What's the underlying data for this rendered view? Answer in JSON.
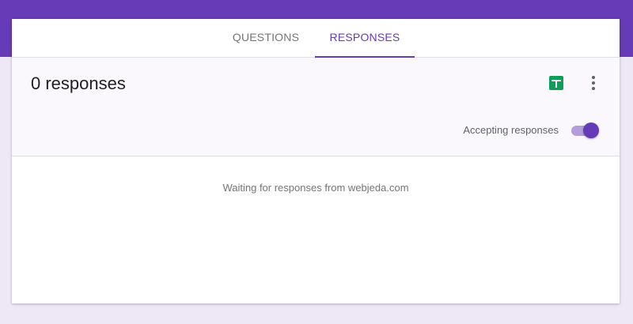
{
  "tabs": [
    {
      "label": "QUESTIONS",
      "active": false
    },
    {
      "label": "RESPONSES",
      "active": true
    }
  ],
  "summary": {
    "count_label": "0 responses",
    "sheets_icon": "google-sheets-icon",
    "more_icon": "more-vert-icon",
    "accepting_label": "Accepting responses",
    "accepting_on": true
  },
  "empty_state": {
    "message": "Waiting for responses from webjeda.com"
  },
  "colors": {
    "primary": "#673ab7",
    "page_background": "#ede7f6",
    "sheets_green": "#0f9d58"
  }
}
